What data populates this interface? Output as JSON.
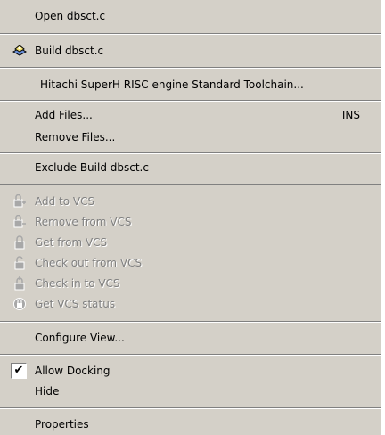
{
  "menu": {
    "open": {
      "label": "Open dbsct.c"
    },
    "build": {
      "label": "Build dbsct.c",
      "icon": "build-icon"
    },
    "toolchain": {
      "label": "Hitachi SuperH RISC engine Standard Toolchain..."
    },
    "add_files": {
      "label": "Add Files...",
      "shortcut": "INS"
    },
    "remove_files": {
      "label": "Remove Files..."
    },
    "exclude_build": {
      "label": "Exclude Build dbsct.c"
    },
    "vcs": [
      {
        "label": "Add to VCS",
        "icon": "vcs-add-icon"
      },
      {
        "label": "Remove from VCS",
        "icon": "vcs-remove-icon"
      },
      {
        "label": "Get from VCS",
        "icon": "vcs-get-icon"
      },
      {
        "label": "Check out from VCS",
        "icon": "vcs-checkout-icon"
      },
      {
        "label": "Check in to VCS",
        "icon": "vcs-checkin-icon"
      },
      {
        "label": "Get VCS status",
        "icon": "vcs-status-icon"
      }
    ],
    "configure_view": {
      "label": "Configure View..."
    },
    "allow_docking": {
      "label": "Allow Docking",
      "checked": true
    },
    "hide": {
      "label": "Hide"
    },
    "properties": {
      "label": "Properties"
    }
  },
  "colors": {
    "menu_bg": "#d4d0c8",
    "disabled_text": "#808080",
    "highlight": "#ffffff"
  }
}
